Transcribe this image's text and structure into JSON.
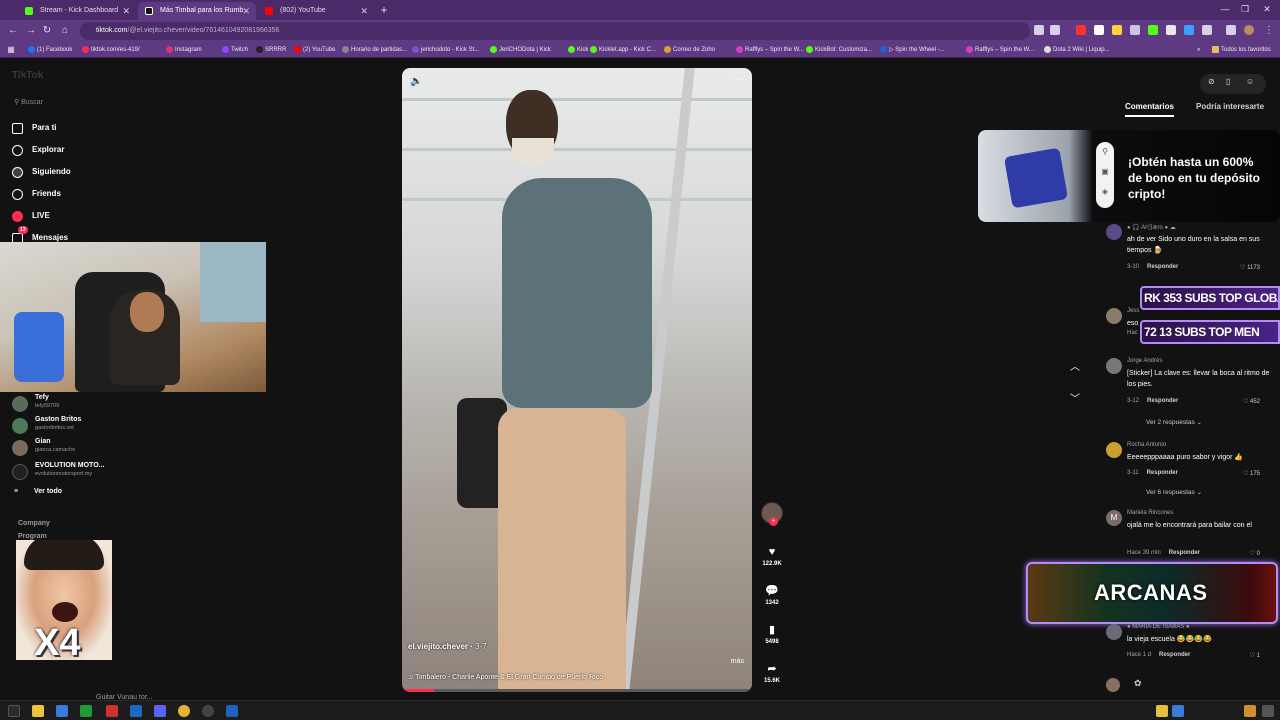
{
  "browser": {
    "tabs": [
      {
        "label": "Stream - Kick Dashboard",
        "color": "#53fc18"
      },
      {
        "label": "Más Timbal para los Rumb",
        "color": "#222222"
      },
      {
        "label": "(802) YouTube",
        "color": "#ff0000"
      }
    ],
    "url_host": "tiktok.com",
    "url_path": "/@el.viejito.chever/video/7614610492081966356",
    "bookmarks": [
      {
        "label": "(1) Facebook",
        "color": "#1877f2"
      },
      {
        "label": "tiktok.com/es-419/",
        "color": "#fe2c55"
      },
      {
        "label": "Instagram",
        "color": "#e1306c"
      },
      {
        "label": "Twitch",
        "color": "#9146ff"
      },
      {
        "label": "SRRRR",
        "color": "#222222"
      },
      {
        "label": "(2) YouTube",
        "color": "#ff0000"
      },
      {
        "label": "Horario de partidas...",
        "color": "#888888"
      },
      {
        "label": "jerichodoto - Kick St...",
        "color": "#6a5acd"
      },
      {
        "label": "JeriCHODota | Kick",
        "color": "#53fc18"
      },
      {
        "label": "Kick",
        "color": "#53fc18"
      },
      {
        "label": "Kicklet.app - Kick C...",
        "color": "#53fc18"
      },
      {
        "label": "Correo de Zoho",
        "color": "#e0a020"
      },
      {
        "label": "Rafflys – Spin the W...",
        "color": "#d040c0"
      },
      {
        "label": "KickBot: Customiza...",
        "color": "#53fc18"
      },
      {
        "label": "▷ Spin the Wheel -...",
        "color": "#2060d0"
      },
      {
        "label": "Rafflys – Spin the W...",
        "color": "#d040c0"
      },
      {
        "label": "Dota 2 Wiki | Liquip...",
        "color": "#dddddd"
      }
    ],
    "all_favorites": "Todos los favoritos"
  },
  "sidebar": {
    "logo": "TikTok",
    "search_placeholder": "Buscar",
    "nav": [
      "Para ti",
      "Explorar",
      "Siguiendo",
      "Friends",
      "LIVE",
      "Mensajes"
    ],
    "messages_badge": "13",
    "following": [
      {
        "name": "Tefy",
        "handle": "tefy59709"
      },
      {
        "name": "Gaston Britos",
        "handle": "gastonbritos.vet"
      },
      {
        "name": "Gian",
        "handle": "gianca.camacho"
      },
      {
        "name": "EVOLUTION MOTO...",
        "handle": "evolutionmotorsport.my"
      }
    ],
    "see_all": "Ver todo",
    "company": "Company",
    "program": "Program",
    "overlay_multiplier": "X4"
  },
  "video": {
    "author": "el.viejito.chever",
    "date": "3-7",
    "more_label": "más",
    "music": "Timbalero - Charlie Aponte & El Gran Combo de Puerto Rico",
    "progress_fraction": 0.09
  },
  "actions": {
    "likes": "122.9K",
    "comments": "1342",
    "saves": "5498",
    "shares": "15.6K"
  },
  "right_panel": {
    "tabs": [
      "Comentarios",
      "Podría interesarte"
    ],
    "promo": "¡Obtén hasta un 600% de bono en tu depósito cripto!",
    "comments": [
      {
        "user": "● 🎧 Ar!ℨ≷ro ● ☁",
        "text": "ah de ver Sido uno duro en la salsa en sus tiempos 🍺",
        "date": "3-10",
        "reply": "Responder",
        "likes": "1173"
      },
      {
        "user": "Jess",
        "text": "eso",
        "date": "Hac",
        "reply": "",
        "likes": ""
      },
      {
        "user": "Jorge Andrés",
        "text": "[Sticker] La clave es: llevar la boca al ritmo de los pies.",
        "date": "3-12",
        "reply": "Responder",
        "likes": "452"
      },
      {
        "user": "Rocha Antonio",
        "text": "Eeeeepppaaaa puro sabor y vigor 👍",
        "date": "3-11",
        "reply": "Responder",
        "likes": "175"
      },
      {
        "user": "Mariela Rincones",
        "text": "ojalá me lo encontrará para bailar con el",
        "date": "Hace 39 min",
        "reply": "Responder",
        "likes": "0"
      },
      {
        "user": "● MARIA DE ISABAS ●",
        "text": "la vieja escuela 😂😂😂😂",
        "date": "Hace 1 d",
        "reply": "Responder",
        "likes": "1"
      }
    ],
    "more_replies": [
      "Ver 2 respuestas ⌄",
      "Ver 6 respuestas ⌄"
    ],
    "subs_overlay": [
      "RK 353 SUBS  TOP GLOBA",
      "72 13 SUBS     TOP MEN"
    ],
    "arcanas": "ARCANAS"
  },
  "taskbar": {
    "ghost_text": "Guitar Vunau tor..."
  },
  "colors": {
    "tiktok_red": "#fe2c55",
    "browser_purple": "#5e3a82",
    "overlay_purple": "#b48cf6"
  }
}
